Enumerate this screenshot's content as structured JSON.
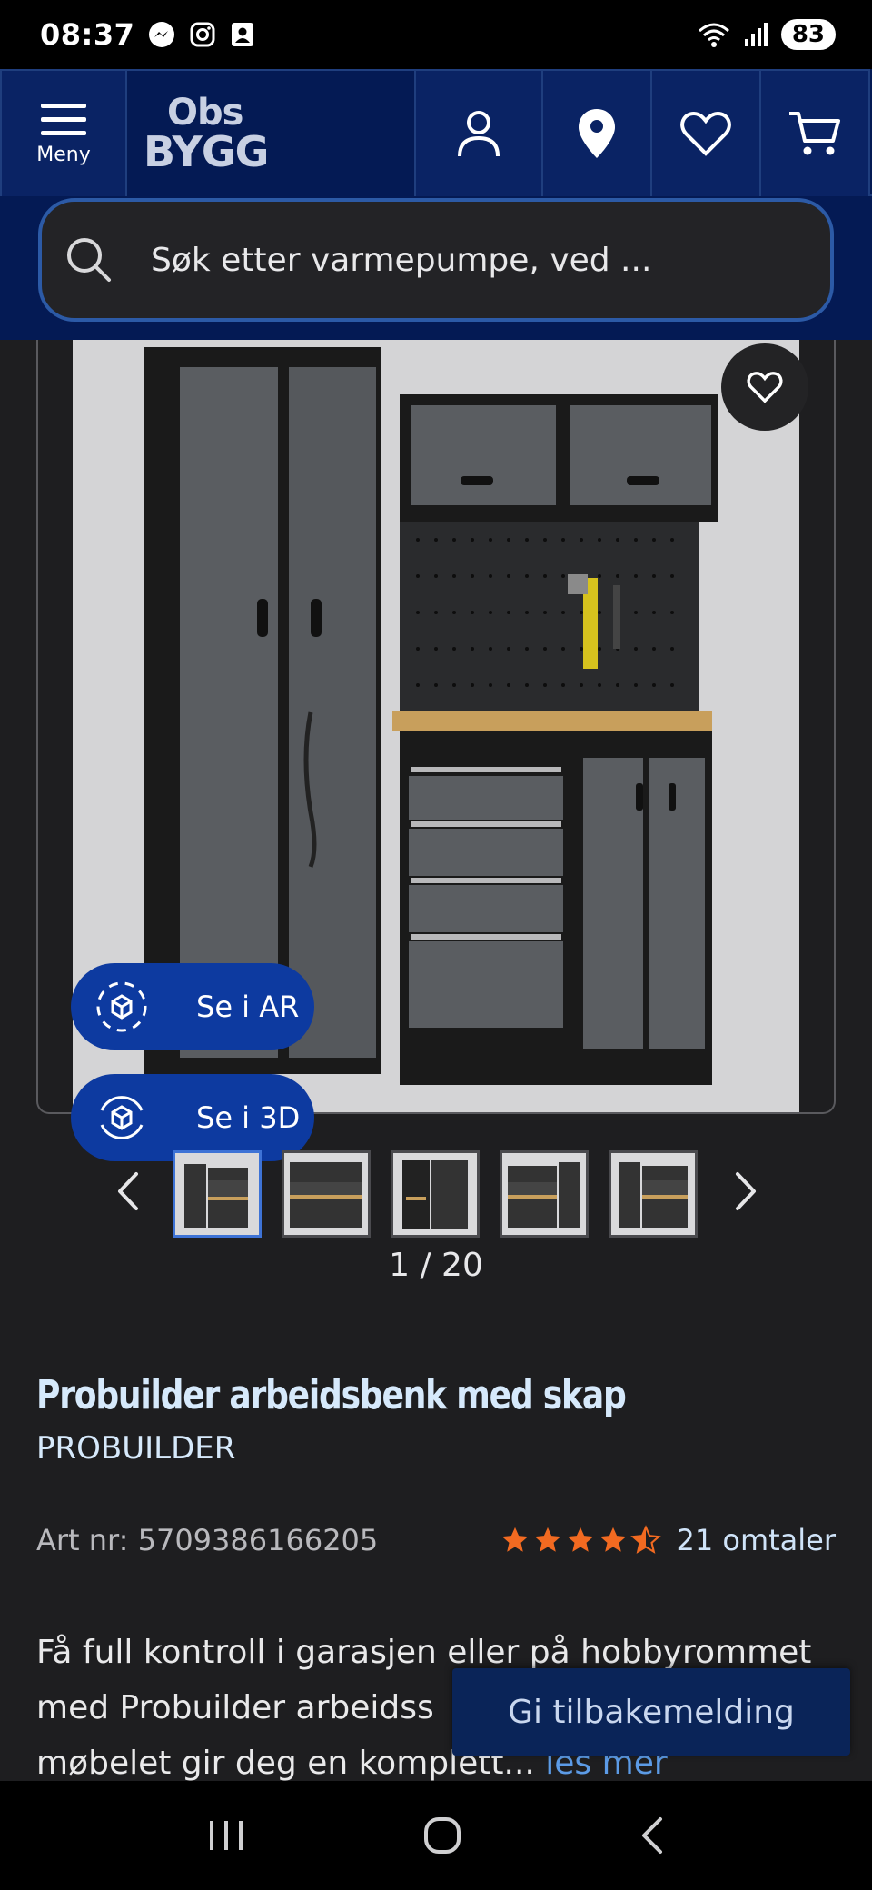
{
  "status": {
    "time": "08:37",
    "battery": "83",
    "icons": [
      "messenger-icon",
      "instagram-icon",
      "contacts-icon",
      "wifi-icon",
      "signal-icon"
    ]
  },
  "header": {
    "menu_label": "Meny",
    "logo_top": "Obs",
    "logo_bottom": "BYGG",
    "icons": [
      "user-icon",
      "location-pin-icon",
      "heart-icon",
      "cart-icon"
    ]
  },
  "search": {
    "placeholder": "Søk etter varmepumpe, ved ..."
  },
  "gallery": {
    "ar_label": "Se i AR",
    "view3d_label": "Se i 3D",
    "counter": "1 / 20",
    "thumb_count": 5,
    "active_index": 0
  },
  "product": {
    "title": "Probuilder arbeidsbenk med skap",
    "brand": "PROBUILDER",
    "art_nr": "Art nr: 5709386166205",
    "rating": 4.5,
    "reviews_label": "21 omtaler",
    "description": "Få full kontroll i garasjen eller på hobbyrommet med Probuilder arbeidss",
    "description_line3": "møbelet gir deg en komplett...",
    "read_more": "les mer"
  },
  "feedback": {
    "label": "Gi tilbakemelding"
  },
  "colors": {
    "navy": "#041a54",
    "accent_blue": "#0d3aa0",
    "star": "#f26a21",
    "title": "#d6e9fb",
    "link": "#5c9be6"
  }
}
